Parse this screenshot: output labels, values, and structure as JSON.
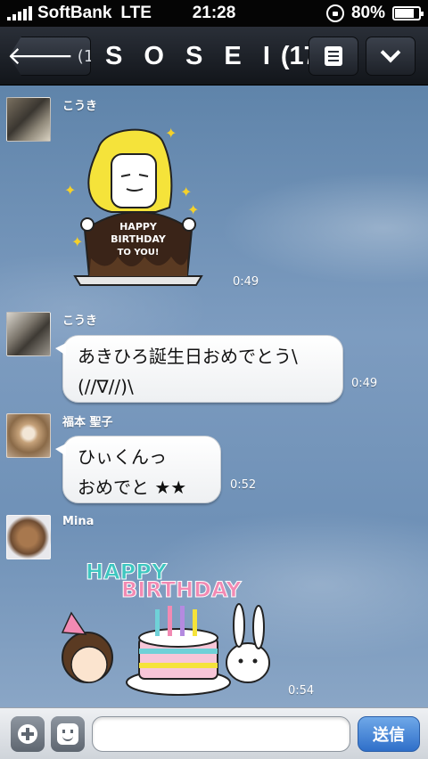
{
  "status_bar": {
    "carrier": "SoftBank",
    "network": "LTE",
    "time": "21:28",
    "battery": "80%",
    "battery_level": 0.8
  },
  "header": {
    "back_count": "(1)",
    "title": "S O S E I",
    "member_count": "(17)"
  },
  "messages": [
    {
      "sender": "こうき",
      "type": "sticker",
      "sticker": "birthday-cake-character",
      "sticker_text": [
        "HAPPY",
        "BIRTHDAY",
        "TO YOU!"
      ],
      "time": "0:49"
    },
    {
      "sender": "こうき",
      "type": "text",
      "text": "あきひろ誕生日おめでとう\\\n(//∇//)\\",
      "time": "0:49"
    },
    {
      "sender": "福本 聖子",
      "type": "text",
      "text": "ひぃくんっ\nおめでと ★★",
      "time": "0:52"
    },
    {
      "sender": "Mina",
      "type": "sticker",
      "sticker": "happy-birthday-cake",
      "sticker_text": [
        "HAPPY",
        "BIRTHDAY"
      ],
      "time": "0:54"
    }
  ],
  "input_bar": {
    "placeholder": "",
    "send_label": "送信"
  },
  "colors": {
    "header_bg": "#1d2128",
    "chat_bg": "#6f91b7",
    "send_button": "#2f6fc9"
  }
}
